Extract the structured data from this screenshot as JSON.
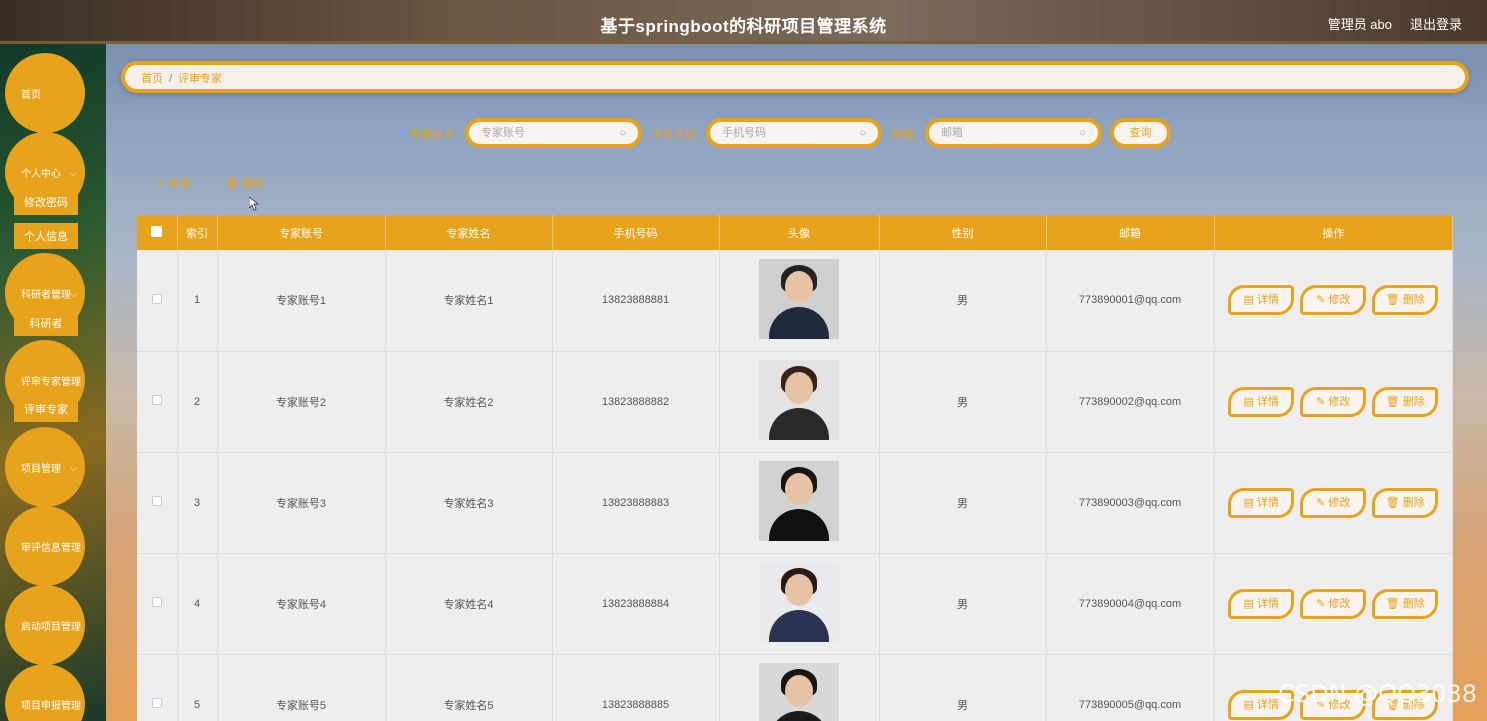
{
  "header": {
    "title": "基于springboot的科研项目管理系统",
    "user": "管理员 abo",
    "logout": "退出登录"
  },
  "sidebar": {
    "home": "首页",
    "personal_center": "个人中心",
    "change_password": "修改密码",
    "personal_info": "个人信息",
    "researcher_mgmt": "科研者管理",
    "researcher": "科研者",
    "expert_mgmt": "评审专家管理",
    "expert": "评审专家",
    "project_mgmt": "项目管理",
    "review_info_mgmt": "审评信息管理",
    "launch_project_mgmt": "启动项目管理",
    "project_apply_mgmt": "项目申报管理"
  },
  "breadcrumb": {
    "home": "首页",
    "separator": "/",
    "current": "评审专家"
  },
  "search": {
    "account_label": "专家账号",
    "account_placeholder": "专家账号",
    "phone_label": "手机号码",
    "phone_placeholder": "手机号码",
    "email_label": "邮箱",
    "email_placeholder": "邮箱",
    "query": "查询"
  },
  "toolbar": {
    "add": "＋ 新增",
    "delete": "🗑 删除"
  },
  "table": {
    "headers": [
      "索引",
      "专家账号",
      "专家姓名",
      "手机号码",
      "头像",
      "性别",
      "邮箱",
      "操作"
    ],
    "rows": [
      {
        "index": "1",
        "account": "专家账号1",
        "name": "专家姓名1",
        "phone": "13823888881",
        "gender": "男",
        "email": "773890001@qq.com"
      },
      {
        "index": "2",
        "account": "专家账号2",
        "name": "专家姓名2",
        "phone": "13823888882",
        "gender": "男",
        "email": "773890002@qq.com"
      },
      {
        "index": "3",
        "account": "专家账号3",
        "name": "专家姓名3",
        "phone": "13823888883",
        "gender": "男",
        "email": "773890003@qq.com"
      },
      {
        "index": "4",
        "account": "专家账号4",
        "name": "专家姓名4",
        "phone": "13823888884",
        "gender": "男",
        "email": "773890004@qq.com"
      },
      {
        "index": "5",
        "account": "专家账号5",
        "name": "专家姓名5",
        "phone": "13823888885",
        "gender": "男",
        "email": "773890005@qq.com"
      }
    ],
    "actions": {
      "detail": "详情",
      "edit": "修改",
      "delete": "删除"
    }
  },
  "watermark": "CSDN @QQ3038",
  "colors": {
    "accent": "#e8a31c"
  }
}
